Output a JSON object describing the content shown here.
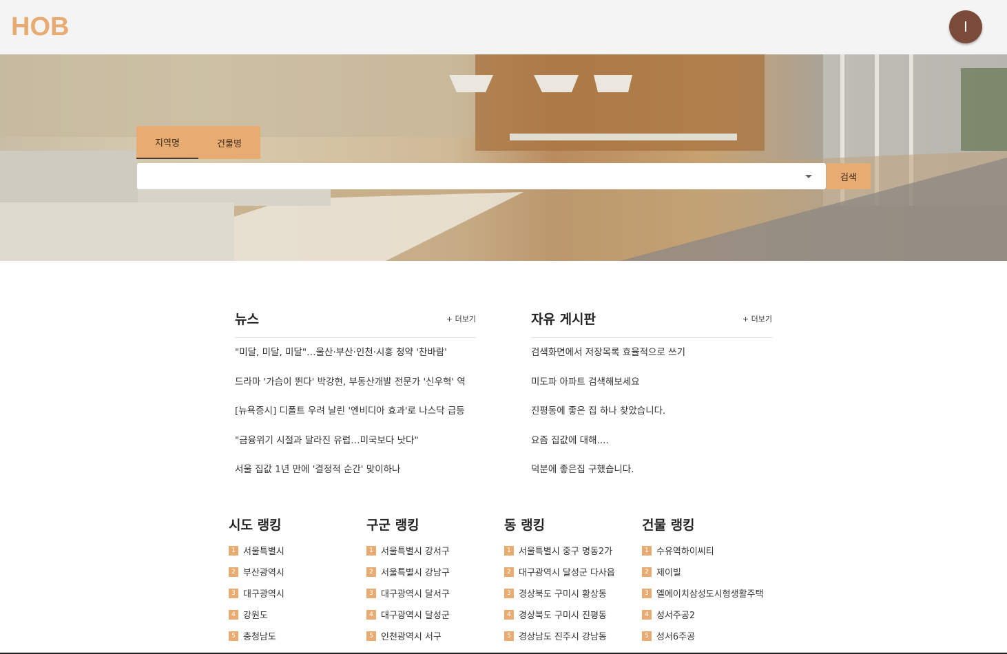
{
  "header": {
    "logo": "HOB",
    "avatar_initial": "I"
  },
  "search": {
    "tabs": [
      {
        "label": "지역명"
      },
      {
        "label": "건물명"
      }
    ],
    "placeholder": "",
    "button_label": "검색"
  },
  "news": {
    "title": "뉴스",
    "more": "+ 더보기",
    "items": [
      "\"미달, 미달, 미달\"…울산·부산·인천·시흥 청약 '찬바람'",
      "드라마 '가슴이 뛴다' 박강현, 부동산개발 전문가 '신우혁' 역",
      "[뉴욕증시] 디폴트 우려 날린 '엔비디아 효과'로 나스닥 급등",
      "\"금융위기 시절과 달라진 유럽…미국보다 낫다\"",
      "서울 집값 1년 만에 '결정적 순간' 맞이하나"
    ]
  },
  "board": {
    "title": "자유 게시판",
    "more": "+ 더보기",
    "items": [
      "검색화면에서 저장목록 효율적으로 쓰기",
      "미도파 아파트 검색해보세요",
      "진평동에 좋은 집 하나 찾았습니다.",
      "요즘 집값에 대해....",
      "덕분에 좋은집 구했습니다."
    ]
  },
  "rankings": [
    {
      "title": "시도 랭킹",
      "items": [
        "서울특별시",
        "부산광역시",
        "대구광역시",
        "강원도",
        "충청남도"
      ]
    },
    {
      "title": "구군 랭킹",
      "items": [
        "서울특별시 강서구",
        "서울특별시 강남구",
        "대구광역시 달서구",
        "대구광역시 달성군",
        "인천광역시 서구"
      ]
    },
    {
      "title": "동 랭킹",
      "items": [
        "서울특별시 중구 명동2가",
        "대구광역시 달성군 다사읍",
        "경상북도 구미시 황상동",
        "경상북도 구미시 진평동",
        "경상남도 진주시 강남동"
      ]
    },
    {
      "title": "건물 랭킹",
      "items": [
        "수유역하이씨티",
        "제이빌",
        "엘에이치삼성도시형생활주택",
        "성서주공2",
        "성서6주공"
      ]
    }
  ],
  "colors": {
    "accent": "#e8ac73",
    "avatar": "#7a4a3b"
  }
}
